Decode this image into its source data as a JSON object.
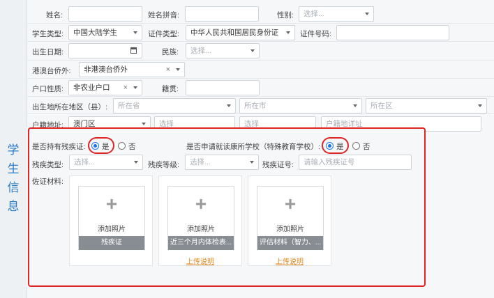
{
  "section_title": [
    "学",
    "生",
    "信",
    "息"
  ],
  "row1": {
    "name_label": "姓名:",
    "name_value": "",
    "pinyin_label": "姓名拼音:",
    "pinyin_value": "",
    "gender_label": "性别:",
    "gender_placeholder": "选择..."
  },
  "row2": {
    "student_type_label": "学生类型:",
    "student_type_value": "中国大陆学生",
    "id_type_label": "证件类型:",
    "id_type_value": "中华人民共和国居民身份证",
    "id_number_label": "证件号码:",
    "id_number_value": ""
  },
  "row3": {
    "birth_label": "出生日期:",
    "birth_value": "",
    "ethnic_label": "民族:",
    "ethnic_placeholder": "选择..."
  },
  "row4": {
    "hmt_label": "港澳台侨外:",
    "hmt_value": "非港澳台侨外",
    "clear": "×"
  },
  "row5": {
    "hukou_label": "户口性质:",
    "hukou_value": "非农业户口",
    "clear": "×",
    "native_label": "籍贯:",
    "native_value": ""
  },
  "row6": {
    "birthplace_label": "出生地所在地区（县）:",
    "province_placeholder": "所在省",
    "city_placeholder": "所在市",
    "district_placeholder": "所在区"
  },
  "row7": {
    "domicile_label": "户籍地址:",
    "domicile_value": "澳门区",
    "p1": "选择",
    "p2": "选择",
    "detail_placeholder": "户籍地详址"
  },
  "disability": {
    "has_cert_label": "是否持有残疾证:",
    "yes": "是",
    "no": "否",
    "has_cert": "是",
    "special_school_label": "是否申请就读康所学校（特殊教育学校）:",
    "special_school": "是",
    "type_label": "残疾类型:",
    "type_placeholder": "选择...",
    "level_label": "残疾等级:",
    "level_placeholder": "选择...",
    "cert_no_label": "残疾证号:",
    "cert_no_placeholder": "请输入残疾证号",
    "materials_label": "佐证材料:",
    "cards": [
      {
        "add": "添加照片",
        "caption": "残疾证",
        "link": ""
      },
      {
        "add": "添加照片",
        "caption": "近三个月内体检表...",
        "link": "上传说明"
      },
      {
        "add": "添加照片",
        "caption": "评估材料（智力、...",
        "link": "上传说明"
      }
    ],
    "plus": "+"
  }
}
